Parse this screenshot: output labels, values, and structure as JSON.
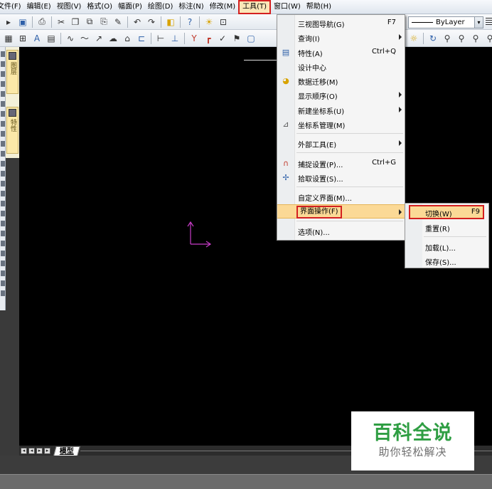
{
  "menubar": {
    "items": [
      "文件(F)",
      "编辑(E)",
      "视图(V)",
      "格式(O)",
      "幅面(P)",
      "绘图(D)",
      "标注(N)",
      "修改(M)",
      "工具(T)",
      "窗口(W)",
      "帮助(H)"
    ]
  },
  "toolbar": {
    "layer_value": "ByLayer"
  },
  "palette": {
    "layer_tab": "图层",
    "property_tab": "特性"
  },
  "tools_menu": {
    "items": [
      {
        "label": "三视图导航(G)",
        "shortcut": "F7"
      },
      {
        "label": "查询(I)"
      },
      {
        "label": "特性(A)",
        "shortcut": "Ctrl+Q"
      },
      {
        "label": "设计中心"
      },
      {
        "label": "数据迁移(M)"
      },
      {
        "label": "显示顺序(O)"
      },
      {
        "label": "新建坐标系(U)"
      },
      {
        "label": "坐标系管理(M)"
      },
      {
        "label": "外部工具(E)"
      },
      {
        "label": "捕捉设置(P)...",
        "shortcut": "Ctrl+G"
      },
      {
        "label": "拾取设置(S)..."
      },
      {
        "label": "自定义界面(M)..."
      },
      {
        "label": "界面操作(F)"
      },
      {
        "label": "选项(N)..."
      }
    ]
  },
  "submenu": {
    "items": [
      {
        "label": "切换(W)",
        "shortcut": "F9"
      },
      {
        "label": "重置(R)"
      },
      {
        "label": "加载(L)..."
      },
      {
        "label": "保存(S)..."
      }
    ]
  },
  "layout_tabs": {
    "model": "模型"
  },
  "watermark": {
    "title": "百科全说",
    "subtitle": "助你轻松解决"
  }
}
